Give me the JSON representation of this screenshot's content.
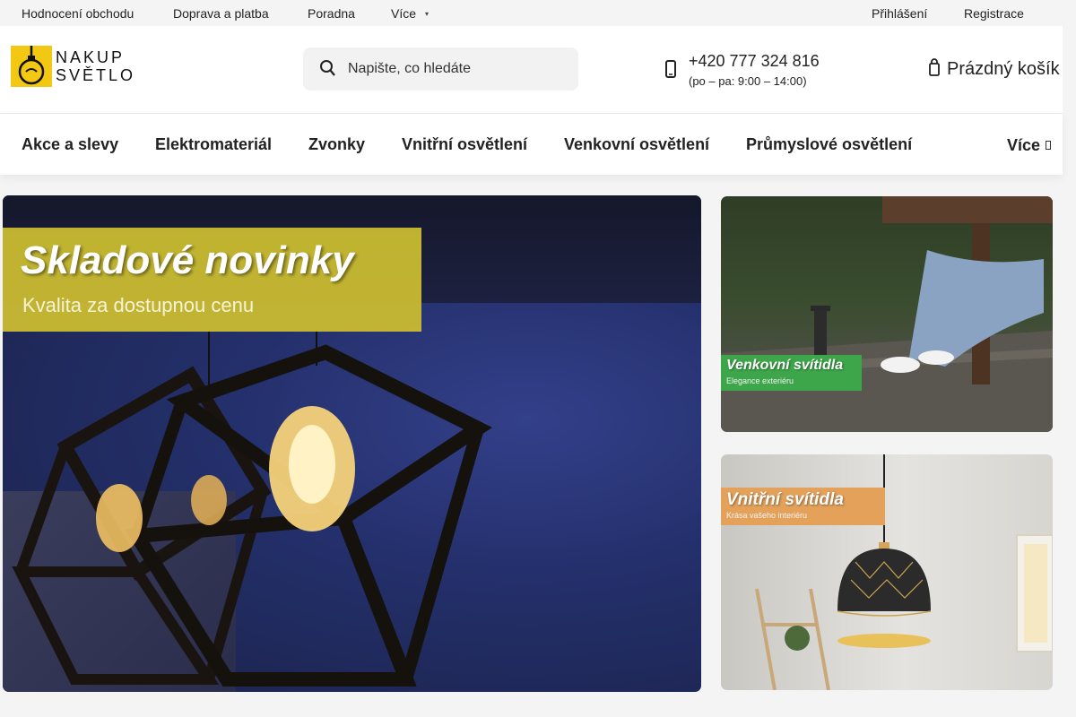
{
  "topbar": {
    "links": [
      "Hodnocení obchodu",
      "Doprava a platba",
      "Poradna",
      "Více"
    ],
    "more_caret": "▾",
    "login": "Přihlášení",
    "register": "Registrace"
  },
  "header": {
    "logo_text_line1": "NAKUP",
    "logo_text_line2": "SVĚTLO",
    "search_placeholder": "Napište, co hledáte",
    "phone_number": "+420 777 324 816",
    "phone_hours": "(po – pa: 9:00 – 14:00)",
    "cart_label": "Prázdný košík"
  },
  "nav": {
    "items": [
      "Akce a slevy",
      "Elektromateriál",
      "Zvonky",
      "Vnitřní osvětlení",
      "Venkovní osvětlení",
      "Průmyslové osvětlení"
    ],
    "more": "Více"
  },
  "banners": {
    "hero": {
      "title": "Skladové novinky",
      "subtitle": "Kvalita za dostupnou cenu"
    },
    "outdoor": {
      "title": "Venkovní svítidla",
      "subtitle": "Elegance exteriéru"
    },
    "indoor": {
      "title": "Vnitřní svítidla",
      "subtitle": "Krása vašeho interiéru"
    }
  },
  "colors": {
    "brand_yellow": "#f2c812",
    "hero_strip": "#cebe30",
    "outdoor_tag": "#3ea64a",
    "indoor_tag": "#e3a15a"
  },
  "icons": [
    "search-icon",
    "phone-icon",
    "cart-icon",
    "chevron-down-icon"
  ]
}
